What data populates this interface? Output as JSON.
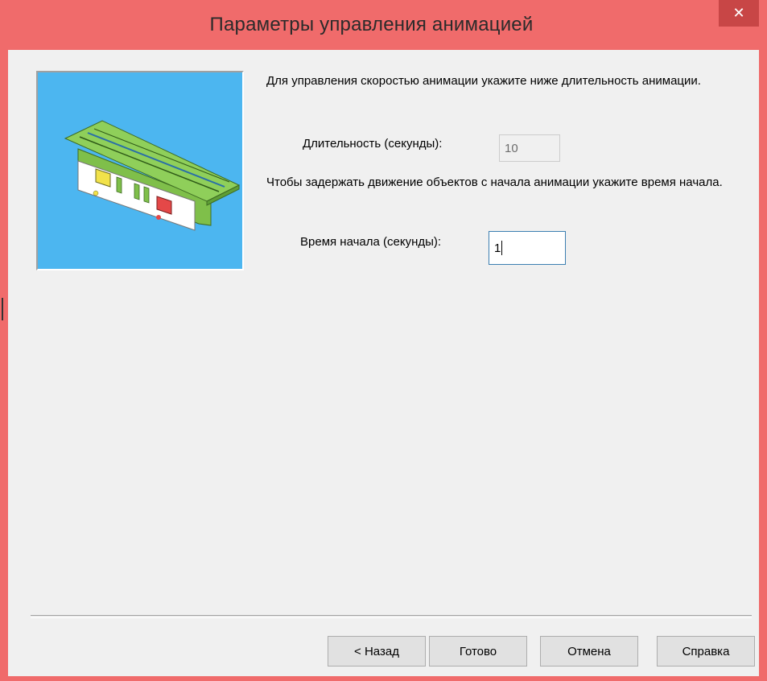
{
  "window": {
    "title": "Параметры управления анимацией",
    "close_label": "✕",
    "accent_color": "#f06b6b"
  },
  "intro": {
    "duration_hint": "Для управления скоростью анимации укажите ниже длительность анимации.",
    "delay_hint": "Чтобы задержать движение объектов с начала анимации укажите время начала."
  },
  "duration": {
    "label": "Длительность (секунды):",
    "value": "10",
    "enabled": false
  },
  "start_time": {
    "label": "Время начала (секунды):",
    "value": "1",
    "focused": true
  },
  "buttons": {
    "back": "< Назад",
    "finish": "Готово",
    "cancel": "Отмена",
    "help": "Справка"
  },
  "icons": {
    "close": "close-icon",
    "preview": "assembly-preview-image"
  }
}
